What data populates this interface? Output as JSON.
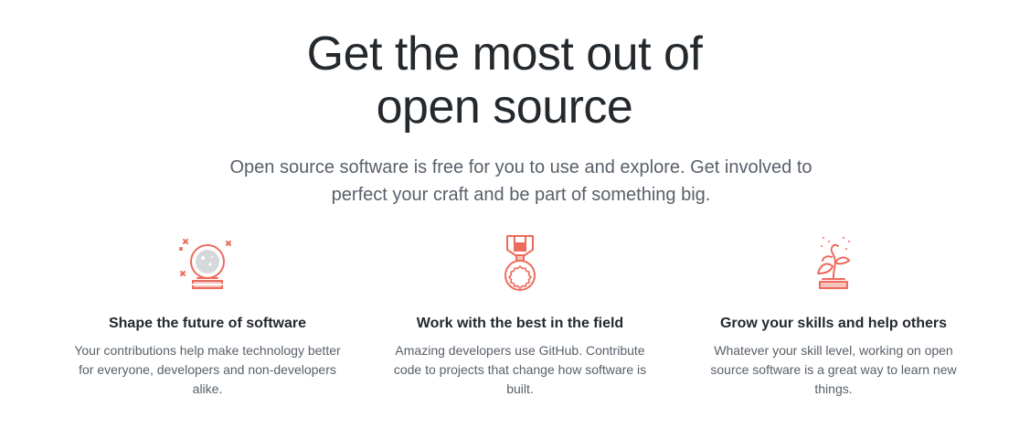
{
  "hero": {
    "title_line1": "Get the most out of",
    "title_line2": "open source",
    "subtitle": "Open source software is free for you to use and explore. Get involved to perfect your craft and be part of something big."
  },
  "features": [
    {
      "icon": "crystal-ball-icon",
      "title": "Shape the future of software",
      "description": "Your contributions help make technology better for everyone, developers and non-developers alike."
    },
    {
      "icon": "medal-icon",
      "title": "Work with the best in the field",
      "description": "Amazing developers use GitHub. Contribute code to projects that change how software is built."
    },
    {
      "icon": "sprouting-plant-icon",
      "title": "Grow your skills and help others",
      "description": "Whatever your skill level, working on open source software is a great way to learn new things."
    }
  ],
  "colors": {
    "icon_accent": "#ec6b5c",
    "heading": "#24292e",
    "body_text": "#586069"
  }
}
